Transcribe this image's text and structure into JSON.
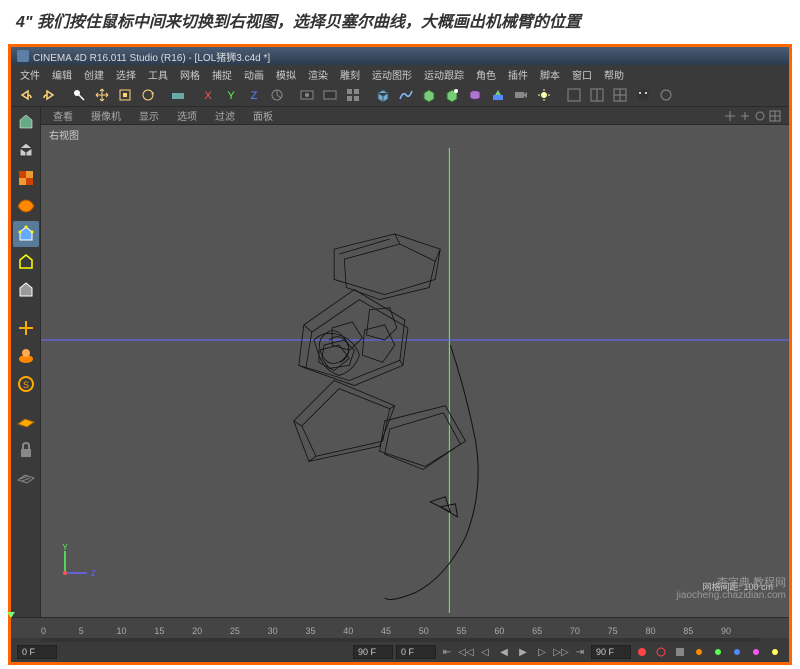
{
  "tutorial": {
    "caption": "4\" 我们按住鼠标中间来切换到右视图，选择贝塞尔曲线，大概画出机械臂的位置"
  },
  "titlebar": {
    "text": "CINEMA 4D R16.011 Studio (R16) - [LOL猪狮3.c4d *]"
  },
  "menu": {
    "items": [
      "文件",
      "编辑",
      "创建",
      "选择",
      "工具",
      "网格",
      "捕捉",
      "动画",
      "模拟",
      "渲染",
      "雕刻",
      "运动图形",
      "运动跟踪",
      "角色",
      "插件",
      "脚本",
      "窗口",
      "帮助"
    ]
  },
  "viewport_header": {
    "tabs": [
      "查看",
      "摄像机",
      "显示",
      "选项",
      "过滤",
      "面板"
    ]
  },
  "viewport": {
    "label": "右视图",
    "grid_text": "网格间距: 100 cm",
    "axis_y": "Y",
    "axis_z": "Z"
  },
  "timeline": {
    "ticks": [
      "0",
      "5",
      "10",
      "15",
      "20",
      "25",
      "30",
      "35",
      "40",
      "45",
      "50",
      "55",
      "60",
      "65",
      "70",
      "75",
      "80",
      "85",
      "90"
    ]
  },
  "bottom": {
    "frame_start": "0 F",
    "frame_end": "90 F",
    "current": "0 F",
    "range_end": "90 F"
  },
  "watermark": {
    "cn": "查字典 教程网",
    "url": "jiaocheng.chazidian.com"
  },
  "icons": {
    "undo": "undo",
    "redo": "redo"
  }
}
